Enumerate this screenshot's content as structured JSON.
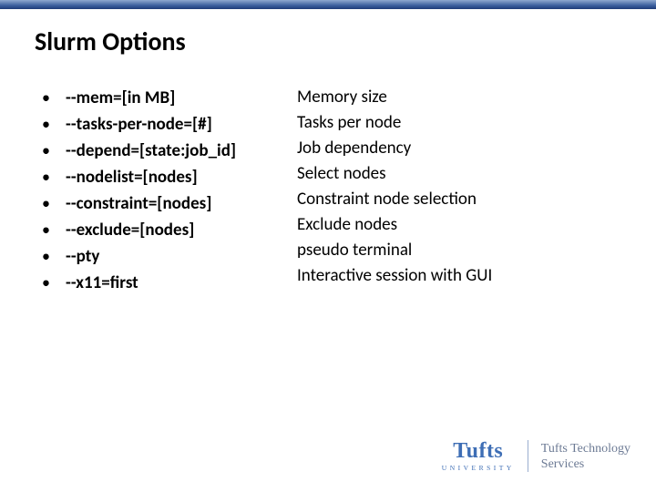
{
  "title": "Slurm Options",
  "items": [
    {
      "option": "--mem=[in MB]",
      "description": "Memory size"
    },
    {
      "option": "--tasks-per-node=[#]",
      "description": "Tasks per node"
    },
    {
      "option": "--depend=[state:job_id]",
      "description": "Job dependency"
    },
    {
      "option": "--nodelist=[nodes]",
      "description": "Select nodes"
    },
    {
      "option": "--constraint=[nodes]",
      "description": "Constraint node selection"
    },
    {
      "option": "--exclude=[nodes]",
      "description": "Exclude nodes"
    },
    {
      "option": "--pty",
      "description": "pseudo terminal"
    },
    {
      "option": "--x11=first",
      "description": "Interactive session with GUI"
    }
  ],
  "footer": {
    "brand": "Tufts",
    "brand_sub": "UNIVERSITY",
    "unit_line1": "Tufts Technology",
    "unit_line2": "Services"
  }
}
